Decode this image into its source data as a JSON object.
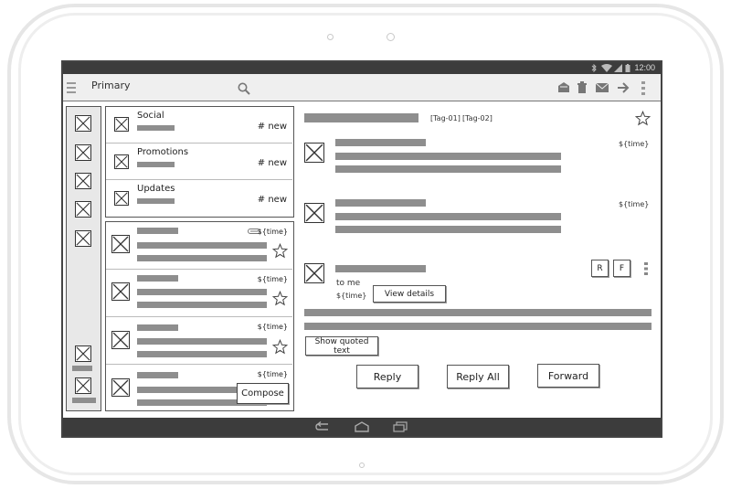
{
  "status_bar": {
    "time": "12:00"
  },
  "action_bar": {
    "title": "Primary"
  },
  "categories": [
    {
      "name": "Social",
      "badge": "# new"
    },
    {
      "name": "Promotions",
      "badge": "# new"
    },
    {
      "name": "Updates",
      "badge": "# new"
    }
  ],
  "messages": [
    {
      "time": "${time}",
      "attachment": true,
      "starred": false
    },
    {
      "time": "${time}",
      "attachment": false,
      "starred": false
    },
    {
      "time": "${time}",
      "attachment": false,
      "starred": false
    },
    {
      "time": "${time}",
      "attachment": false,
      "starred": false
    }
  ],
  "compose_label": "Compose",
  "reading_pane": {
    "tags": [
      "[Tag-01]",
      "[Tag-02]"
    ],
    "thread": [
      {
        "time": "${time}"
      },
      {
        "time": "${time}"
      }
    ],
    "open_message": {
      "to": "to me",
      "time": "${time}",
      "view_details_label": "View details",
      "reply_short_label": "R",
      "forward_short_label": "F"
    },
    "show_quoted_label": "Show quoted text",
    "actions": {
      "reply": "Reply",
      "reply_all": "Reply All",
      "forward": "Forward"
    }
  }
}
